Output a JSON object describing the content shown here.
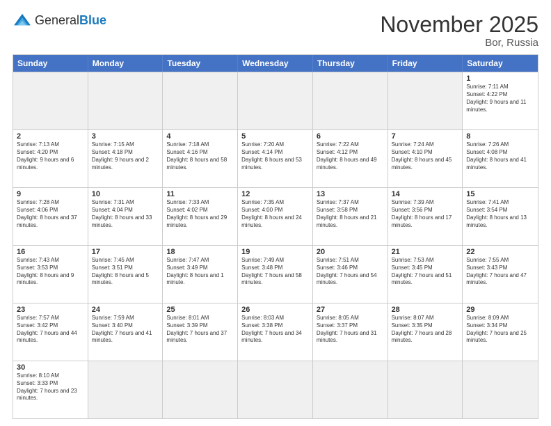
{
  "header": {
    "logo": {
      "general": "General",
      "blue": "Blue"
    },
    "title": "November 2025",
    "location": "Bor, Russia"
  },
  "days": [
    "Sunday",
    "Monday",
    "Tuesday",
    "Wednesday",
    "Thursday",
    "Friday",
    "Saturday"
  ],
  "rows": [
    [
      {
        "date": "",
        "empty": true
      },
      {
        "date": "",
        "empty": true
      },
      {
        "date": "",
        "empty": true
      },
      {
        "date": "",
        "empty": true
      },
      {
        "date": "",
        "empty": true
      },
      {
        "date": "",
        "empty": true
      },
      {
        "date": "1",
        "info": "Sunrise: 7:11 AM\nSunset: 4:22 PM\nDaylight: 9 hours and 11 minutes."
      }
    ],
    [
      {
        "date": "2",
        "info": "Sunrise: 7:13 AM\nSunset: 4:20 PM\nDaylight: 9 hours and 6 minutes."
      },
      {
        "date": "3",
        "info": "Sunrise: 7:15 AM\nSunset: 4:18 PM\nDaylight: 9 hours and 2 minutes."
      },
      {
        "date": "4",
        "info": "Sunrise: 7:18 AM\nSunset: 4:16 PM\nDaylight: 8 hours and 58 minutes."
      },
      {
        "date": "5",
        "info": "Sunrise: 7:20 AM\nSunset: 4:14 PM\nDaylight: 8 hours and 53 minutes."
      },
      {
        "date": "6",
        "info": "Sunrise: 7:22 AM\nSunset: 4:12 PM\nDaylight: 8 hours and 49 minutes."
      },
      {
        "date": "7",
        "info": "Sunrise: 7:24 AM\nSunset: 4:10 PM\nDaylight: 8 hours and 45 minutes."
      },
      {
        "date": "8",
        "info": "Sunrise: 7:26 AM\nSunset: 4:08 PM\nDaylight: 8 hours and 41 minutes."
      }
    ],
    [
      {
        "date": "9",
        "info": "Sunrise: 7:28 AM\nSunset: 4:06 PM\nDaylight: 8 hours and 37 minutes."
      },
      {
        "date": "10",
        "info": "Sunrise: 7:31 AM\nSunset: 4:04 PM\nDaylight: 8 hours and 33 minutes."
      },
      {
        "date": "11",
        "info": "Sunrise: 7:33 AM\nSunset: 4:02 PM\nDaylight: 8 hours and 29 minutes."
      },
      {
        "date": "12",
        "info": "Sunrise: 7:35 AM\nSunset: 4:00 PM\nDaylight: 8 hours and 24 minutes."
      },
      {
        "date": "13",
        "info": "Sunrise: 7:37 AM\nSunset: 3:58 PM\nDaylight: 8 hours and 21 minutes."
      },
      {
        "date": "14",
        "info": "Sunrise: 7:39 AM\nSunset: 3:56 PM\nDaylight: 8 hours and 17 minutes."
      },
      {
        "date": "15",
        "info": "Sunrise: 7:41 AM\nSunset: 3:54 PM\nDaylight: 8 hours and 13 minutes."
      }
    ],
    [
      {
        "date": "16",
        "info": "Sunrise: 7:43 AM\nSunset: 3:53 PM\nDaylight: 8 hours and 9 minutes."
      },
      {
        "date": "17",
        "info": "Sunrise: 7:45 AM\nSunset: 3:51 PM\nDaylight: 8 hours and 5 minutes."
      },
      {
        "date": "18",
        "info": "Sunrise: 7:47 AM\nSunset: 3:49 PM\nDaylight: 8 hours and 1 minute."
      },
      {
        "date": "19",
        "info": "Sunrise: 7:49 AM\nSunset: 3:48 PM\nDaylight: 7 hours and 58 minutes."
      },
      {
        "date": "20",
        "info": "Sunrise: 7:51 AM\nSunset: 3:46 PM\nDaylight: 7 hours and 54 minutes."
      },
      {
        "date": "21",
        "info": "Sunrise: 7:53 AM\nSunset: 3:45 PM\nDaylight: 7 hours and 51 minutes."
      },
      {
        "date": "22",
        "info": "Sunrise: 7:55 AM\nSunset: 3:43 PM\nDaylight: 7 hours and 47 minutes."
      }
    ],
    [
      {
        "date": "23",
        "info": "Sunrise: 7:57 AM\nSunset: 3:42 PM\nDaylight: 7 hours and 44 minutes."
      },
      {
        "date": "24",
        "info": "Sunrise: 7:59 AM\nSunset: 3:40 PM\nDaylight: 7 hours and 41 minutes."
      },
      {
        "date": "25",
        "info": "Sunrise: 8:01 AM\nSunset: 3:39 PM\nDaylight: 7 hours and 37 minutes."
      },
      {
        "date": "26",
        "info": "Sunrise: 8:03 AM\nSunset: 3:38 PM\nDaylight: 7 hours and 34 minutes."
      },
      {
        "date": "27",
        "info": "Sunrise: 8:05 AM\nSunset: 3:37 PM\nDaylight: 7 hours and 31 minutes."
      },
      {
        "date": "28",
        "info": "Sunrise: 8:07 AM\nSunset: 3:35 PM\nDaylight: 7 hours and 28 minutes."
      },
      {
        "date": "29",
        "info": "Sunrise: 8:09 AM\nSunset: 3:34 PM\nDaylight: 7 hours and 25 minutes."
      }
    ],
    [
      {
        "date": "30",
        "info": "Sunrise: 8:10 AM\nSunset: 3:33 PM\nDaylight: 7 hours and 23 minutes."
      },
      {
        "date": "",
        "empty": true
      },
      {
        "date": "",
        "empty": true
      },
      {
        "date": "",
        "empty": true
      },
      {
        "date": "",
        "empty": true
      },
      {
        "date": "",
        "empty": true
      },
      {
        "date": "",
        "empty": true
      }
    ]
  ]
}
